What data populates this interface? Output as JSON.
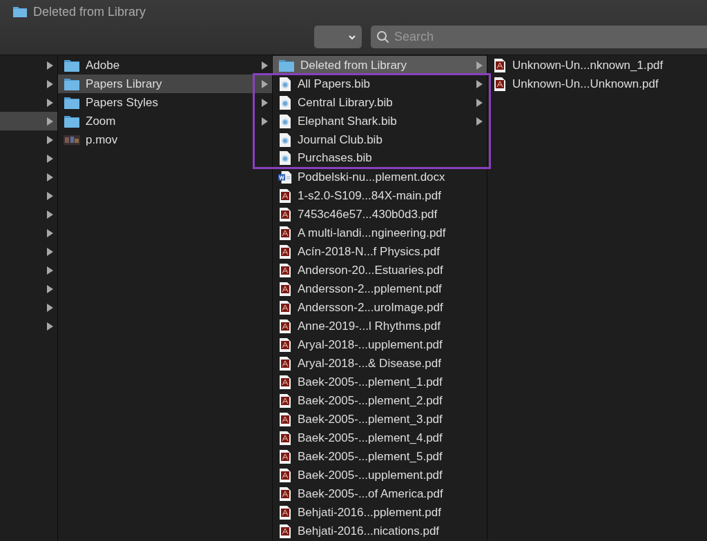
{
  "window": {
    "title": "Deleted from Library"
  },
  "toolbar": {
    "search": {
      "placeholder": "Search"
    }
  },
  "column_1": {
    "rows": [
      {
        "selected": false
      },
      {
        "selected": false
      },
      {
        "selected": false
      },
      {
        "selected": true
      },
      {
        "selected": false
      },
      {
        "selected": false
      },
      {
        "selected": false
      },
      {
        "selected": false
      },
      {
        "selected": false
      },
      {
        "selected": false
      },
      {
        "selected": false
      },
      {
        "selected": false
      },
      {
        "selected": false
      },
      {
        "selected": false
      },
      {
        "selected": false
      }
    ]
  },
  "column_2": {
    "items": [
      {
        "name": "Adobe",
        "kind": "folder",
        "expandable": true,
        "selected": false
      },
      {
        "name": "Papers Library",
        "kind": "folder",
        "expandable": true,
        "selected": true
      },
      {
        "name": "Papers Styles",
        "kind": "folder",
        "expandable": true,
        "selected": false
      },
      {
        "name": "Zoom",
        "kind": "folder",
        "expandable": true,
        "selected": false
      },
      {
        "name": "p.mov",
        "kind": "movie",
        "expandable": false,
        "selected": false
      }
    ]
  },
  "column_3": {
    "items": [
      {
        "name": "Deleted from Library",
        "kind": "folder",
        "expandable": true,
        "selected": true
      },
      {
        "kind": "highlight_frame",
        "items": [
          {
            "name": "All Papers.bib",
            "kind": "bib",
            "expandable": true,
            "selected": false
          },
          {
            "name": "Central Library.bib",
            "kind": "bib",
            "expandable": true,
            "selected": false
          },
          {
            "name": "Elephant Shark.bib",
            "kind": "bib",
            "expandable": true,
            "selected": false
          },
          {
            "name": "Journal Club.bib",
            "kind": "bib",
            "expandable": false,
            "selected": false
          },
          {
            "name": "Purchases.bib",
            "kind": "bib",
            "expandable": false,
            "selected": false
          }
        ]
      },
      {
        "name": "Podbelski-nu...plement.docx",
        "kind": "docx",
        "expandable": false,
        "selected": false
      },
      {
        "name": "1-s2.0-S109...84X-main.pdf",
        "kind": "pdf",
        "expandable": false,
        "selected": false
      },
      {
        "name": "7453c46e57...430b0d3.pdf",
        "kind": "pdf",
        "expandable": false,
        "selected": false
      },
      {
        "name": "A multi-landi...ngineering.pdf",
        "kind": "pdf",
        "expandable": false,
        "selected": false
      },
      {
        "name": "Acín-2018-N...f Physics.pdf",
        "kind": "pdf",
        "expandable": false,
        "selected": false
      },
      {
        "name": "Anderson-20...Estuaries.pdf",
        "kind": "pdf",
        "expandable": false,
        "selected": false
      },
      {
        "name": "Andersson-2...pplement.pdf",
        "kind": "pdf",
        "expandable": false,
        "selected": false
      },
      {
        "name": "Andersson-2...uroImage.pdf",
        "kind": "pdf",
        "expandable": false,
        "selected": false
      },
      {
        "name": "Anne-2019-...l Rhythms.pdf",
        "kind": "pdf",
        "expandable": false,
        "selected": false
      },
      {
        "name": "Aryal-2018-...upplement.pdf",
        "kind": "pdf",
        "expandable": false,
        "selected": false
      },
      {
        "name": "Aryal-2018-...& Disease.pdf",
        "kind": "pdf",
        "expandable": false,
        "selected": false
      },
      {
        "name": "Baek-2005-...plement_1.pdf",
        "kind": "pdf",
        "expandable": false,
        "selected": false
      },
      {
        "name": "Baek-2005-...plement_2.pdf",
        "kind": "pdf",
        "expandable": false,
        "selected": false
      },
      {
        "name": "Baek-2005-...plement_3.pdf",
        "kind": "pdf",
        "expandable": false,
        "selected": false
      },
      {
        "name": "Baek-2005-...plement_4.pdf",
        "kind": "pdf",
        "expandable": false,
        "selected": false
      },
      {
        "name": "Baek-2005-...plement_5.pdf",
        "kind": "pdf",
        "expandable": false,
        "selected": false
      },
      {
        "name": "Baek-2005-...upplement.pdf",
        "kind": "pdf",
        "expandable": false,
        "selected": false
      },
      {
        "name": "Baek-2005-...of America.pdf",
        "kind": "pdf",
        "expandable": false,
        "selected": false
      },
      {
        "name": "Behjati-2016...pplement.pdf",
        "kind": "pdf",
        "expandable": false,
        "selected": false
      },
      {
        "name": "Behjati-2016...nications.pdf",
        "kind": "pdf",
        "expandable": false,
        "selected": false
      }
    ]
  },
  "column_4": {
    "items": [
      {
        "name": "Unknown-Un...nknown_1.pdf",
        "kind": "pdf",
        "expandable": false,
        "selected": false
      },
      {
        "name": "Unknown-Un...Unknown.pdf",
        "kind": "pdf",
        "expandable": false,
        "selected": false
      }
    ]
  }
}
